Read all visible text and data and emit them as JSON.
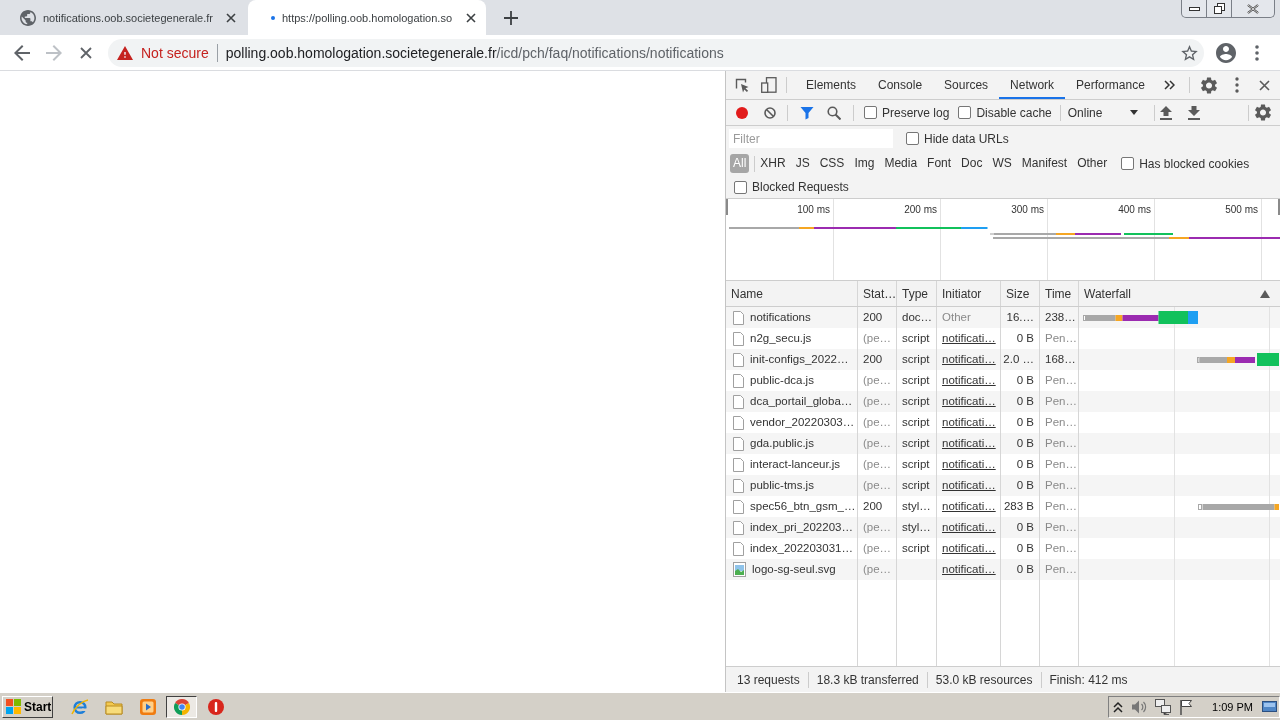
{
  "browser": {
    "tabs": [
      {
        "title": "notifications.oob.societegenerale.fr",
        "selected": false,
        "loading": false
      },
      {
        "title": "https://polling.oob.homologation.so",
        "selected": true,
        "loading": true
      }
    ],
    "toolbar": {
      "can_go_forward": false,
      "loading": true
    },
    "omnibox": {
      "security": "Not secure",
      "host": "polling.oob.homologation.societegenerale.fr",
      "path": "/icd/pch/faq/notifications/notifications"
    }
  },
  "devtools": {
    "panels": [
      {
        "label": "Elements",
        "selected": false
      },
      {
        "label": "Console",
        "selected": false
      },
      {
        "label": "Sources",
        "selected": false
      },
      {
        "label": "Network",
        "selected": true
      },
      {
        "label": "Performance",
        "selected": false
      }
    ],
    "toolbar": {
      "recording": true,
      "options": [
        {
          "label": "Preserve log",
          "checked": false
        },
        {
          "label": "Disable cache",
          "checked": false
        }
      ],
      "throttling": "Online"
    },
    "filter": {
      "placeholder": "Filter",
      "hide_data_urls": {
        "label": "Hide data URLs",
        "checked": false
      },
      "types": [
        {
          "label": "All",
          "selected": true
        },
        {
          "label": "XHR",
          "selected": false
        },
        {
          "label": "JS",
          "selected": false
        },
        {
          "label": "CSS",
          "selected": false
        },
        {
          "label": "Img",
          "selected": false
        },
        {
          "label": "Media",
          "selected": false
        },
        {
          "label": "Font",
          "selected": false
        },
        {
          "label": "Doc",
          "selected": false
        },
        {
          "label": "WS",
          "selected": false
        },
        {
          "label": "Manifest",
          "selected": false
        },
        {
          "label": "Other",
          "selected": false
        }
      ],
      "blocked_cookies": {
        "label": "Has blocked cookies",
        "checked": false
      },
      "blocked_requests": {
        "label": "Blocked Requests",
        "checked": false
      }
    },
    "overview": {
      "ticks": [
        "100 ms",
        "200 ms",
        "300 ms",
        "400 ms",
        "500 ms"
      ]
    },
    "table": {
      "columns": [
        "Name",
        "Stat…",
        "Type",
        "Initiator",
        "Size",
        "Time",
        "Waterfall"
      ],
      "rows": [
        {
          "kind": "document",
          "name": "notifications",
          "status": "200",
          "status_pending": false,
          "type": "doc…",
          "initiator": "Other",
          "initiator_link": false,
          "size": "16.…",
          "time": "238…",
          "time_pending": false,
          "waterfall": {
            "kind": "finished"
          }
        },
        {
          "kind": "document",
          "name": "n2g_secu.js",
          "status": "(pe…",
          "status_pending": true,
          "type": "script",
          "initiator": "notificati…",
          "initiator_link": true,
          "size": "0 B",
          "time": "Pen…",
          "time_pending": true
        },
        {
          "kind": "document",
          "name": "init-configs_2022…",
          "status": "200",
          "status_pending": false,
          "type": "script",
          "initiator": "notificati…",
          "initiator_link": true,
          "size": "2.0 …",
          "time": "168…",
          "time_pending": false,
          "waterfall": {
            "kind": "receiving"
          }
        },
        {
          "kind": "document",
          "name": "public-dca.js",
          "status": "(pe…",
          "status_pending": true,
          "type": "script",
          "initiator": "notificati…",
          "initiator_link": true,
          "size": "0 B",
          "time": "Pen…",
          "time_pending": true
        },
        {
          "kind": "document",
          "name": "dca_portail_globa…",
          "status": "(pe…",
          "status_pending": true,
          "type": "script",
          "initiator": "notificati…",
          "initiator_link": true,
          "size": "0 B",
          "time": "Pen…",
          "time_pending": true
        },
        {
          "kind": "document",
          "name": "vendor_20220303…",
          "status": "(pe…",
          "status_pending": true,
          "type": "script",
          "initiator": "notificati…",
          "initiator_link": true,
          "size": "0 B",
          "time": "Pen…",
          "time_pending": true
        },
        {
          "kind": "document",
          "name": "gda.public.js",
          "status": "(pe…",
          "status_pending": true,
          "type": "script",
          "initiator": "notificati…",
          "initiator_link": true,
          "size": "0 B",
          "time": "Pen…",
          "time_pending": true
        },
        {
          "kind": "document",
          "name": "interact-lanceur.js",
          "status": "(pe…",
          "status_pending": true,
          "type": "script",
          "initiator": "notificati…",
          "initiator_link": true,
          "size": "0 B",
          "time": "Pen…",
          "time_pending": true
        },
        {
          "kind": "document",
          "name": "public-tms.js",
          "status": "(pe…",
          "status_pending": true,
          "type": "script",
          "initiator": "notificati…",
          "initiator_link": true,
          "size": "0 B",
          "time": "Pen…",
          "time_pending": true
        },
        {
          "kind": "document",
          "name": "spec56_btn_gsm_…",
          "status": "200",
          "status_pending": false,
          "type": "styl…",
          "initiator": "notificati…",
          "initiator_link": true,
          "size": "283 B",
          "time": "Pen…",
          "time_pending": true,
          "waterfall": {
            "kind": "queued"
          }
        },
        {
          "kind": "document",
          "name": "index_pri_202203…",
          "status": "(pe…",
          "status_pending": true,
          "type": "styl…",
          "initiator": "notificati…",
          "initiator_link": true,
          "size": "0 B",
          "time": "Pen…",
          "time_pending": true
        },
        {
          "kind": "document",
          "name": "index_202203031…",
          "status": "(pe…",
          "status_pending": true,
          "type": "script",
          "initiator": "notificati…",
          "initiator_link": true,
          "size": "0 B",
          "time": "Pen…",
          "time_pending": true
        },
        {
          "kind": "image",
          "name": "logo-sg-seul.svg",
          "status": "(pe…",
          "status_pending": true,
          "initiator": "notificati…",
          "initiator_link": true,
          "size": "0 B",
          "time": "Pen…",
          "time_pending": true
        }
      ]
    },
    "status_bar": [
      "13 requests",
      "18.3 kB transferred",
      "53.0 kB resources",
      "Finish: 412 ms"
    ]
  },
  "taskbar": {
    "start": "Start",
    "apps": [
      {
        "kind": "web",
        "selected": false
      },
      {
        "kind": "folder",
        "selected": false
      },
      {
        "kind": "media",
        "selected": false
      },
      {
        "kind": "browser",
        "selected": true
      },
      {
        "kind": "alert",
        "selected": false
      }
    ],
    "clock": "1:09 PM"
  }
}
